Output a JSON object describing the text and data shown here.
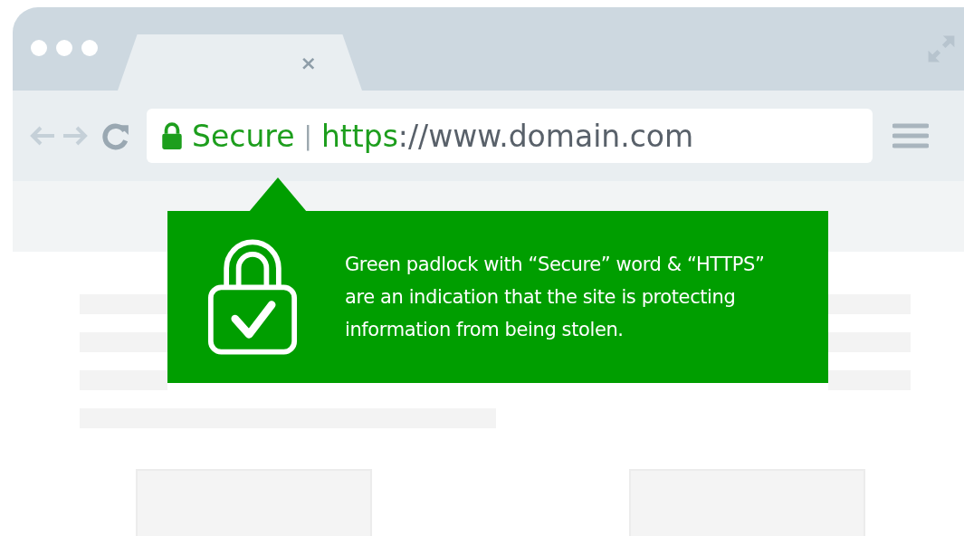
{
  "tab": {
    "close": "×"
  },
  "address_bar": {
    "secure_label": "Secure",
    "separator": "|",
    "scheme": "https",
    "rest": "://www.domain.com"
  },
  "callout": {
    "text": "Green padlock with “Secure” word & “HTTPS” are an indication that the site is protecting information from being stolen."
  }
}
